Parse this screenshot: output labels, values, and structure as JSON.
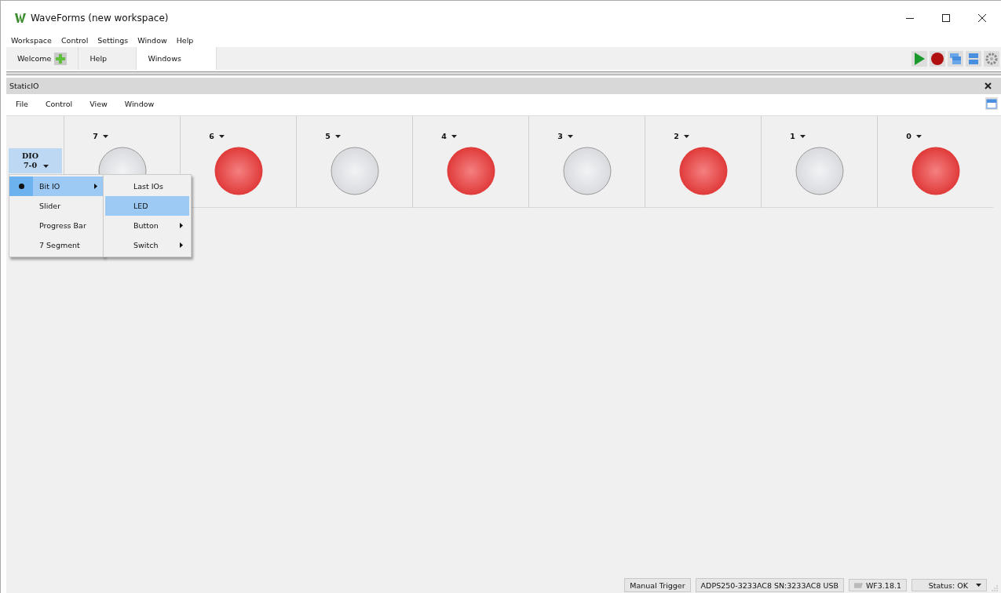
{
  "window": {
    "title": "WaveForms (new workspace)"
  },
  "menu_bar": [
    "Workspace",
    "Control",
    "Settings",
    "Window",
    "Help"
  ],
  "tabs": [
    {
      "label": "Welcome",
      "selected": false,
      "add_button": true
    },
    {
      "label": "Help",
      "selected": false,
      "add_button": false
    },
    {
      "label": "Windows",
      "selected": true,
      "add_button": false
    }
  ],
  "instrument": {
    "title": "StaticIO",
    "menu_bar": [
      "File",
      "Control",
      "View",
      "Window"
    ],
    "group": {
      "label": "DIO\n7-0"
    },
    "channels": [
      {
        "label": "7",
        "on": false
      },
      {
        "label": "6",
        "on": true
      },
      {
        "label": "5",
        "on": false
      },
      {
        "label": "4",
        "on": true
      },
      {
        "label": "3",
        "on": false
      },
      {
        "label": "2",
        "on": true
      },
      {
        "label": "1",
        "on": false
      },
      {
        "label": "0",
        "on": true
      }
    ]
  },
  "context_menu": {
    "items": [
      {
        "label": "Bit IO",
        "checked": true,
        "selected": true,
        "submenu": true
      },
      {
        "label": "Slider",
        "checked": false,
        "selected": false,
        "submenu": false
      },
      {
        "label": "Progress Bar",
        "checked": false,
        "selected": false,
        "submenu": false
      },
      {
        "label": "7 Segment",
        "checked": false,
        "selected": false,
        "submenu": false
      }
    ],
    "submenu": [
      {
        "label": "Last IOs",
        "selected": false,
        "submenu": false
      },
      {
        "label": "LED",
        "selected": true,
        "submenu": false
      },
      {
        "label": "Button",
        "selected": false,
        "submenu": true
      },
      {
        "label": "Switch",
        "selected": false,
        "submenu": true
      }
    ]
  },
  "status_bar": [
    {
      "label": "Manual Trigger",
      "kind": "button"
    },
    {
      "label": "ADPS250-3233AC8 SN:3233AC8 USB",
      "kind": "text"
    },
    {
      "label": "WF3.18.1",
      "kind": "version"
    },
    {
      "label": "Status: OK",
      "kind": "dropdown"
    }
  ]
}
